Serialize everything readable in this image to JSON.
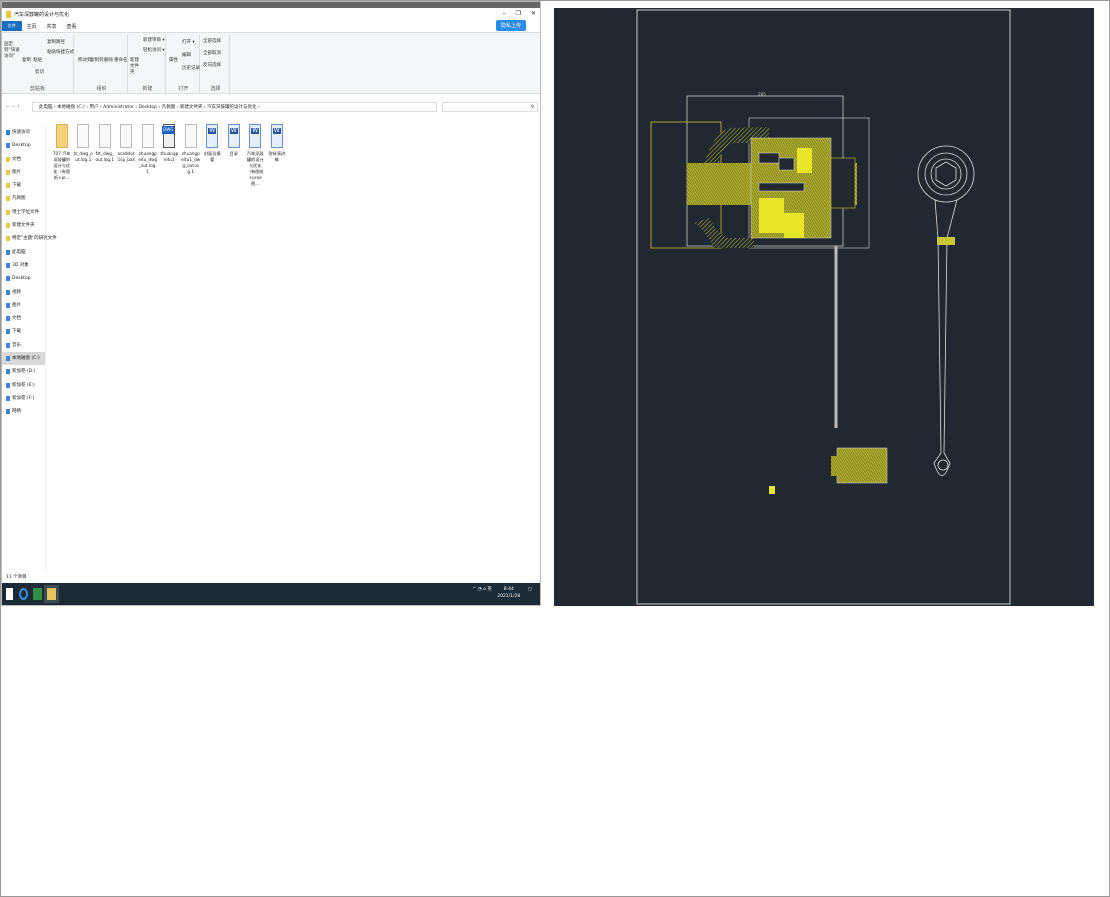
{
  "explorer": {
    "title": "汽车深鼓罐的设计与优化",
    "window_controls": [
      "–",
      "❐",
      "✕"
    ],
    "tabs": [
      "文件",
      "主页",
      "共享",
      "查看"
    ],
    "help_label": "隐私上传",
    "ribbon": {
      "clipboard": {
        "label": "剪贴板",
        "pin": "固定到\"快速访问\"",
        "copy": "复制",
        "paste": "粘贴",
        "cut": "剪切",
        "copy_path": "复制路径",
        "paste_shortcut": "粘贴快捷方式"
      },
      "organize": {
        "label": "组织",
        "move_to": "移动到",
        "copy_to": "复制到",
        "delete": "删除",
        "rename": "重命名"
      },
      "new": {
        "label": "新建",
        "new_folder": "新建文件夹",
        "new_item": "新建项目 ▾",
        "easy_access": "轻松访问 ▾"
      },
      "open": {
        "label": "打开",
        "properties": "属性",
        "open": "打开 ▾",
        "edit": "编辑",
        "history": "历史记录"
      },
      "select": {
        "label": "选择",
        "select_all": "全部选择",
        "select_none": "全部取消",
        "invert": "反向选择"
      }
    },
    "breadcrumb": [
      "此电脑",
      "本地磁盘 (C:)",
      "用户",
      "Administrator",
      "Desktop",
      "凡佩图",
      "新建文件夹",
      "汽车深鼓罐的设计与优化"
    ],
    "nav": [
      "快速访问",
      "Desktop",
      "文档",
      "图片",
      "下载",
      "凡佩图",
      "博士学位文件",
      "新建文件夹",
      "特定\"主题\"的研究文件",
      "此电脑",
      "3D 对象",
      "Desktop",
      "视频",
      "图片",
      "文档",
      "下载",
      "音乐",
      "本地磁盘 (C:)",
      "新加卷 (D:)",
      "新加卷 (E:)",
      "新加卷 (F:)",
      "网络"
    ],
    "selected_nav": "本地磁盘 (C:)",
    "files": [
      {
        "name": "707 汽车深鼓罐的设计与优化（有图纸+pr...",
        "type": "folder"
      },
      {
        "name": "fz_dwg_out.log.1",
        "type": "file"
      },
      {
        "name": "fzt_dwg_out.log.1",
        "type": "file"
      },
      {
        "name": "acaddoc1sp_bak",
        "type": "file"
      },
      {
        "name": "zhuangpeitu_dwg_out.log.1",
        "type": "file"
      },
      {
        "name": "zhuangpeitu1",
        "type": "dwg"
      },
      {
        "name": "zhuangpeitu1_dwg_out.log.1",
        "type": "file"
      },
      {
        "name": "封面及摘要",
        "type": "word"
      },
      {
        "name": "目录",
        "type": "word"
      },
      {
        "name": "汽车深鼓罐的设计与优化（有图纸+proe图...",
        "type": "word"
      },
      {
        "name": "答辩演讲稿",
        "type": "word"
      }
    ],
    "status": "11 个项目",
    "taskbar": {
      "time": "8:44",
      "date": "2021/1/28",
      "ime": "英"
    }
  },
  "cad": {
    "dimension_label": "265",
    "colors": {
      "background": "#212830",
      "part": "#c8c832",
      "frame": "#e0e0e0"
    }
  }
}
